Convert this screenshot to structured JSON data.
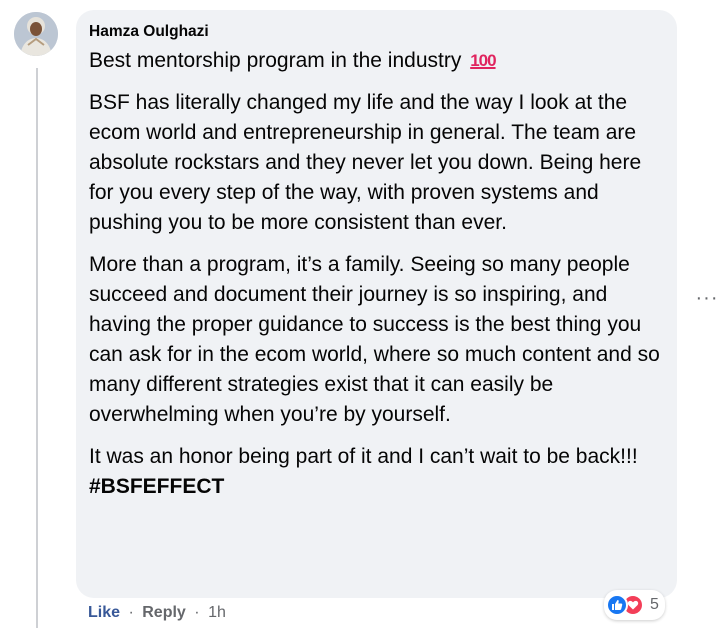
{
  "comment": {
    "author": "Hamza Oulghazi",
    "paragraphs": [
      "Best mentorship program in the industry",
      "BSF has literally changed my life and the way I look at the ecom world and entrepreneurship in general. The team are absolute rockstars and they never let you down. Being here for you every step of the way, with proven systems and pushing you to be more consistent than ever.",
      "More than a program, it’s a family. Seeing so many people succeed and document their journey is so inspiring, and having the proper guidance to success is the best thing you can ask for in the ecom world, where so much content and so many different strategies exist that it can easily be overwhelming when you’re by yourself.",
      "It was an honor being part of it and I can’t wait to be back!!!"
    ],
    "emoji": "100",
    "hashtag": "#BSFEFFECT",
    "more_icon": "···"
  },
  "actions": {
    "like_label": "Like",
    "reply_label": "Reply",
    "separator": "·",
    "timestamp": "1h"
  },
  "reactions": {
    "icons": [
      "like-icon",
      "love-icon"
    ],
    "count": "5"
  },
  "colors": {
    "bubble": "#f0f2f5",
    "like_link": "#385898",
    "secondary_text": "#65676b",
    "like_reaction": "#1877f2",
    "love_reaction": "#f33e58",
    "emoji_100": "#e0245e"
  }
}
